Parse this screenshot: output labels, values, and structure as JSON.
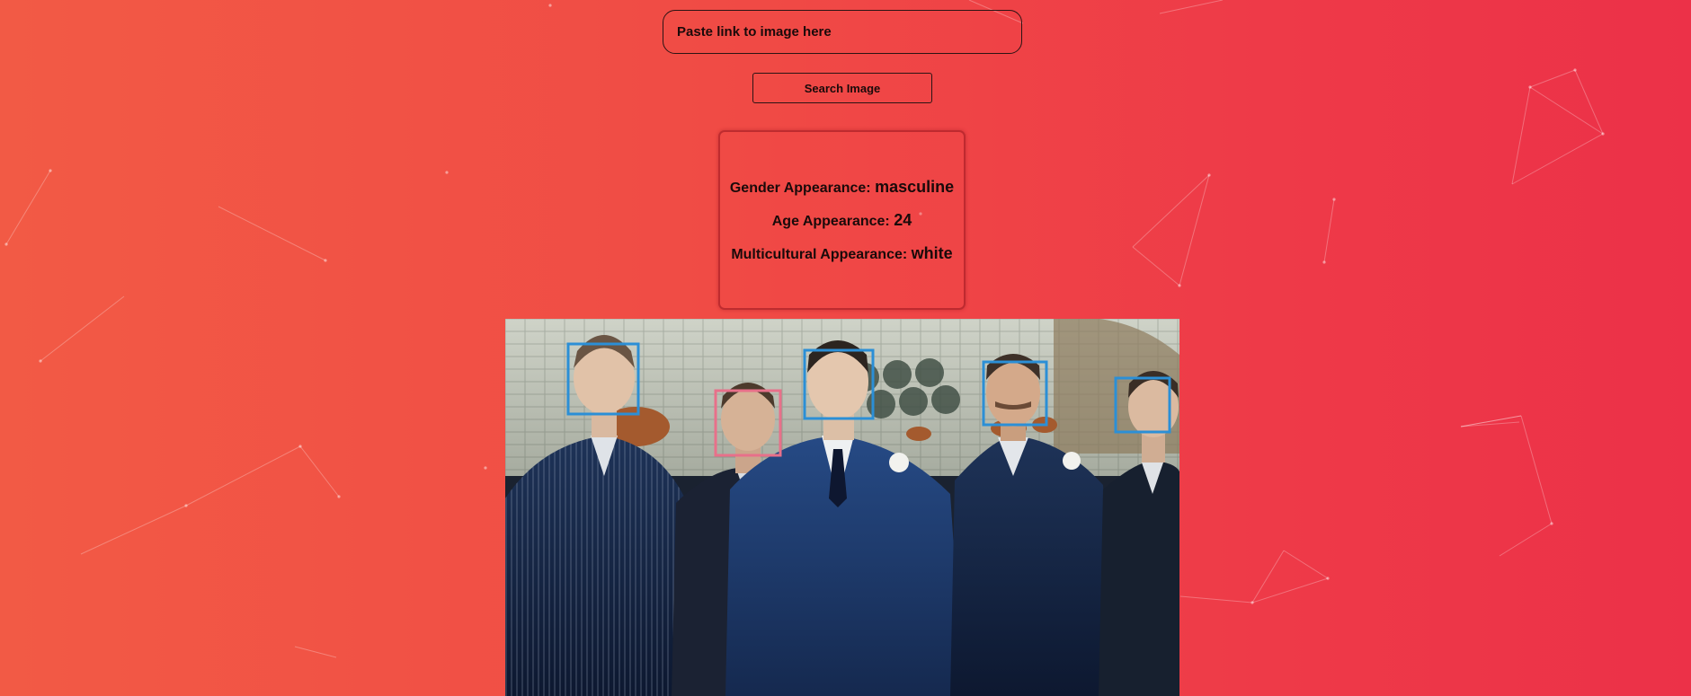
{
  "search": {
    "placeholder": "Paste link to image here",
    "button_label": "Search Image"
  },
  "result": {
    "gender_label": "Gender Appearance:",
    "gender_value": "masculine",
    "age_label": "Age Appearance:",
    "age_value": "24",
    "culture_label": "Multicultural Appearance:",
    "culture_value": "white"
  },
  "colors": {
    "face_box_default": "#2b8fd6",
    "face_box_selected": "#e8708a"
  }
}
